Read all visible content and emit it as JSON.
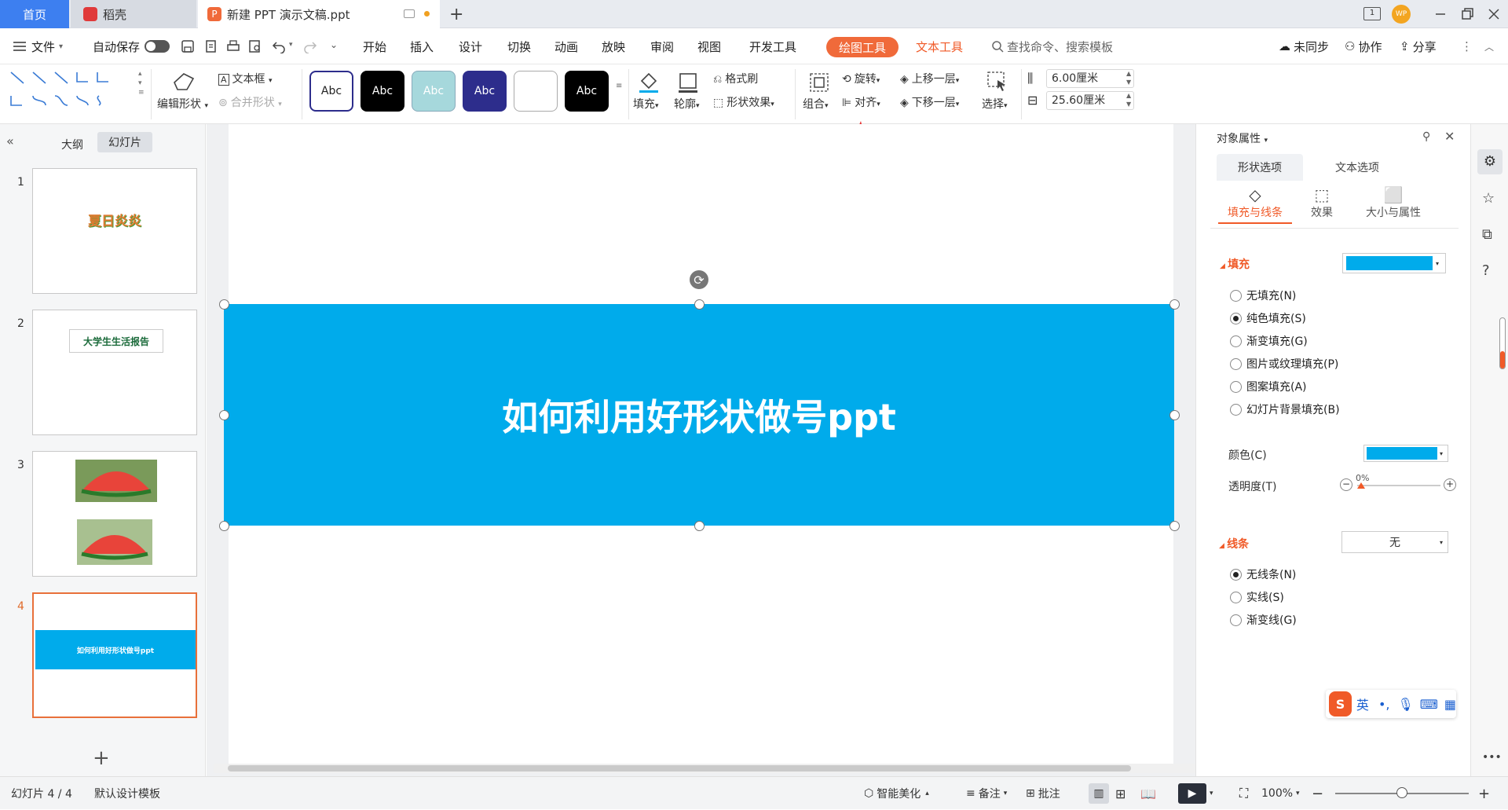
{
  "titlebar": {
    "home_tab": "首页",
    "daoke_tab": "稻壳",
    "doc_tab": "新建 PPT 演示文稿.ppt",
    "new_tab": "+",
    "avatar_text": "WP"
  },
  "menubar": {
    "file": "文件",
    "autosave": "自动保存",
    "items": [
      "开始",
      "插入",
      "设计",
      "切换",
      "动画",
      "放映",
      "审阅",
      "视图",
      "开发工具"
    ],
    "drawing_tools": "绘图工具",
    "text_tools": "文本工具",
    "search_placeholder": "查找命令、搜索模板",
    "sync": "未同步",
    "collab": "协作",
    "share": "分享"
  },
  "ribbon": {
    "edit_shape": "编辑形状",
    "textbox": "文本框",
    "merge_shape": "合并形状",
    "style_samples": [
      "Abc",
      "Abc",
      "Abc",
      "Abc",
      "",
      "Abc"
    ],
    "fill": "填充",
    "outline": "轮廓",
    "format_painter": "格式刷",
    "shape_effect": "形状效果",
    "group": "组合",
    "rotate": "旋转",
    "align": "对齐",
    "bring_forward": "上移一层",
    "send_backward": "下移一层",
    "select": "选择",
    "height": "6.00厘米",
    "width": "25.60厘米"
  },
  "left_panel": {
    "tab_outline": "大纲",
    "tab_slides": "幻灯片",
    "slides": [
      {
        "num": "1",
        "text": "夏日炎炎"
      },
      {
        "num": "2",
        "text": "大学生生活报告"
      },
      {
        "num": "3",
        "text": ""
      },
      {
        "num": "4",
        "text": "如何利用好形状做号ppt"
      }
    ],
    "add_slide": "+"
  },
  "slide": {
    "shape_text": "如何利用好形状做号ppt"
  },
  "right_panel": {
    "title": "对象属性",
    "tab_shape": "形状选项",
    "tab_text": "文本选项",
    "sub_fill_line": "填充与线条",
    "sub_effect": "效果",
    "sub_size": "大小与属性",
    "fill_section": "填充",
    "fill_options": [
      "无填充(N)",
      "纯色填充(S)",
      "渐变填充(G)",
      "图片或纹理填充(P)",
      "图案填充(A)",
      "幻灯片背景填充(B)"
    ],
    "color_label": "颜色(C)",
    "transparency_label": "透明度(T)",
    "transparency_value": "0%",
    "line_section": "线条",
    "line_value": "无",
    "line_options": [
      "无线条(N)",
      "实线(S)",
      "渐变线(G)"
    ],
    "fill_color": "#00abeb"
  },
  "ime": {
    "label": "英"
  },
  "statusbar": {
    "slide_info": "幻灯片 4 / 4",
    "template": "默认设计模板",
    "beautify": "智能美化",
    "notes": "备注",
    "comments": "批注",
    "zoom": "100%"
  }
}
